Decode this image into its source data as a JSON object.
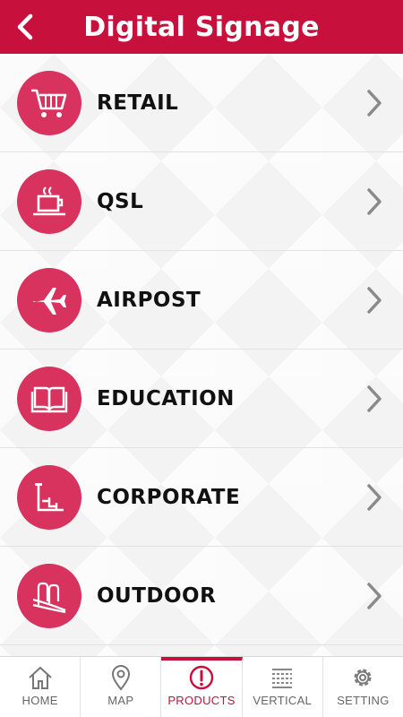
{
  "header": {
    "title": "Digital Signage",
    "back_icon": "chevron-left-icon"
  },
  "colors": {
    "accent": "#c8103d",
    "icon_circle": "#d8325f"
  },
  "categories": [
    {
      "label": "RETAIL",
      "icon": "shopping-cart-icon"
    },
    {
      "label": "QSL",
      "icon": "coffee-cup-icon"
    },
    {
      "label": "AIRPOST",
      "icon": "airplane-icon"
    },
    {
      "label": "EDUCATION",
      "icon": "book-icon"
    },
    {
      "label": "CORPORATE",
      "icon": "chart-icon"
    },
    {
      "label": "OUTDOOR",
      "icon": "outdoor-sign-icon"
    }
  ],
  "nav": [
    {
      "label": "HOME",
      "icon": "home-icon",
      "active": false
    },
    {
      "label": "MAP",
      "icon": "map-pin-icon",
      "active": false
    },
    {
      "label": "PRODUCTS",
      "icon": "alert-icon",
      "active": true
    },
    {
      "label": "VERTICAL",
      "icon": "list-grid-icon",
      "active": false
    },
    {
      "label": "SETTING",
      "icon": "gear-icon",
      "active": false
    }
  ]
}
